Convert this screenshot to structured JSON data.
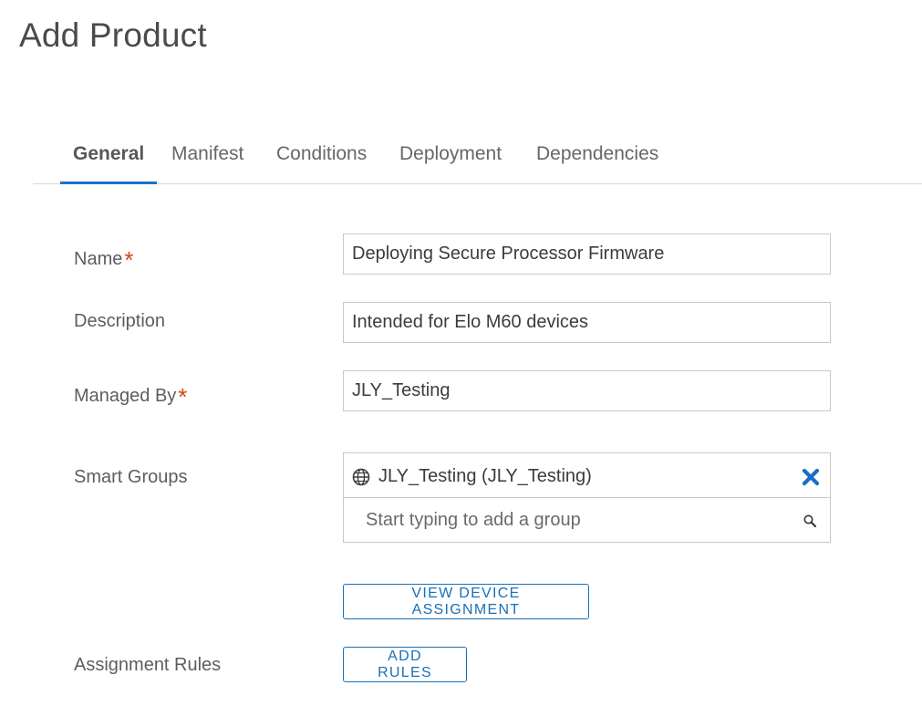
{
  "page": {
    "title": "Add Product"
  },
  "tabs": [
    {
      "label": "General",
      "active": true
    },
    {
      "label": "Manifest",
      "active": false
    },
    {
      "label": "Conditions",
      "active": false
    },
    {
      "label": "Deployment",
      "active": false
    },
    {
      "label": "Dependencies",
      "active": false
    }
  ],
  "form": {
    "name": {
      "label": "Name",
      "required_mark": "*",
      "value": "Deploying Secure Processor Firmware"
    },
    "description": {
      "label": "Description",
      "value": "Intended for Elo M60 devices"
    },
    "managed_by": {
      "label": "Managed By",
      "required_mark": "*",
      "value": "JLY_Testing"
    },
    "smart_groups": {
      "label": "Smart Groups",
      "selected": [
        {
          "text": "JLY_Testing (JLY_Testing)",
          "icon": "globe-icon"
        }
      ],
      "placeholder": "Start typing to add a group",
      "remove_icon": "close-icon",
      "search_icon": "search-icon"
    },
    "view_device_assignment_label": "VIEW DEVICE ASSIGNMENT",
    "assignment_rules": {
      "label": "Assignment Rules",
      "add_rules_label": "ADD RULES"
    }
  },
  "colors": {
    "accent": "#1a73c9",
    "required": "#d0451b",
    "button_text": "#1a6fb5"
  }
}
